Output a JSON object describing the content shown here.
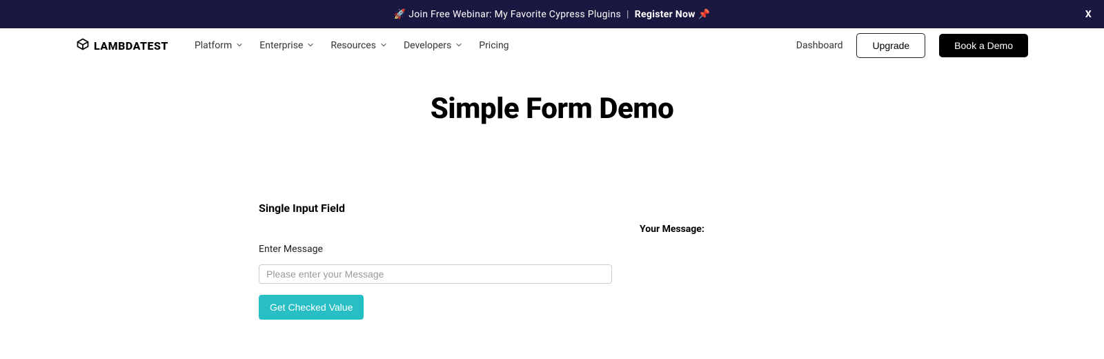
{
  "banner": {
    "rocket_emoji": "🚀",
    "text": "Join Free Webinar: My Favorite Cypress Plugins",
    "divider": "|",
    "register_label": "Register Now",
    "pin_emoji": "📌",
    "close_label": "X"
  },
  "header": {
    "logo_text": "LAMBDATEST",
    "nav": [
      {
        "label": "Platform",
        "has_chevron": true
      },
      {
        "label": "Enterprise",
        "has_chevron": true
      },
      {
        "label": "Resources",
        "has_chevron": true
      },
      {
        "label": "Developers",
        "has_chevron": true
      },
      {
        "label": "Pricing",
        "has_chevron": false
      }
    ],
    "dashboard_label": "Dashboard",
    "upgrade_label": "Upgrade",
    "book_demo_label": "Book a Demo"
  },
  "page": {
    "title": "Simple Form Demo"
  },
  "form": {
    "section_heading": "Single Input Field",
    "message_label": "Enter Message",
    "message_placeholder": "Please enter your Message",
    "message_value": "",
    "submit_label": "Get Checked Value"
  },
  "output": {
    "your_message_label": "Your Message:"
  }
}
